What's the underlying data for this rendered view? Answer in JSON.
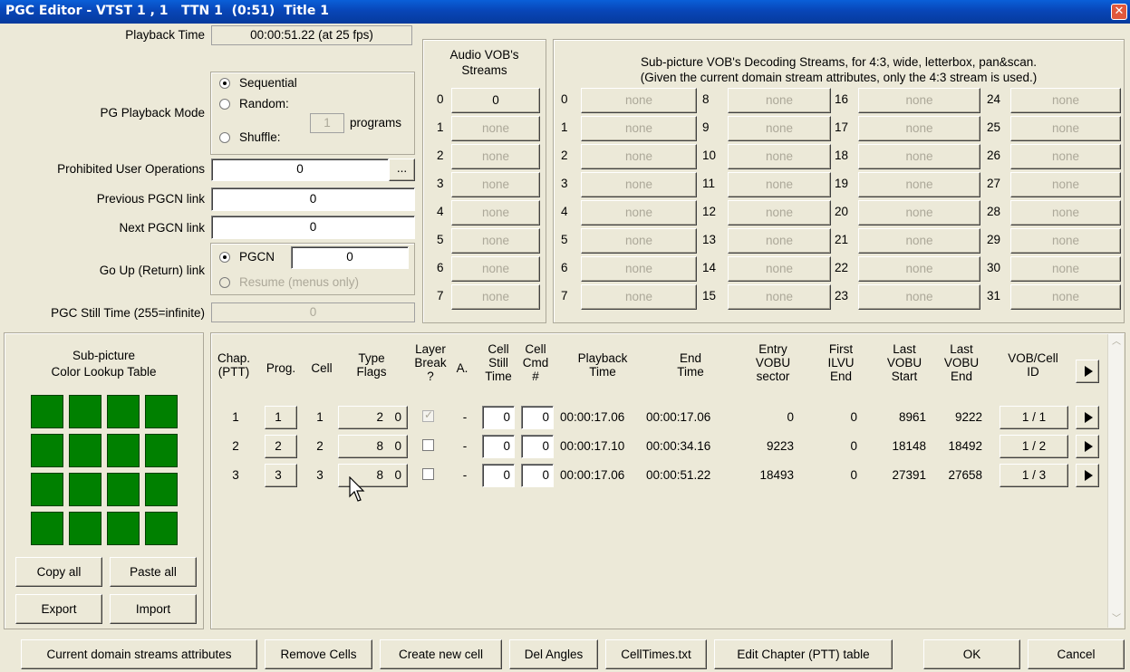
{
  "window": {
    "title": "PGC Editor - VTST 1 , 1   TTN 1  (0:51)  Title 1",
    "close_glyph": "✕"
  },
  "left_form": {
    "playback_time_label": "Playback Time",
    "playback_time_value": "00:00:51.22 (at 25 fps)",
    "pg_playback_mode_label": "PG Playback Mode",
    "mode_sequential": "Sequential",
    "mode_random": "Random:",
    "mode_shuffle": "Shuffle:",
    "programs_value": "1",
    "programs_label": "programs",
    "prohibited_label": "Prohibited User Operations",
    "prohibited_value": "0",
    "prohibited_more": "...",
    "prev_pgcn_label": "Previous PGCN link",
    "prev_pgcn_value": "0",
    "next_pgcn_label": "Next PGCN link",
    "next_pgcn_value": "0",
    "go_up_label": "Go Up (Return) link",
    "pgcn_radio_label": "PGCN",
    "go_up_pgcn_value": "0",
    "resume_label": "Resume (menus only)",
    "still_time_label": "PGC Still Time (255=infinite)",
    "still_time_value": "0"
  },
  "audio": {
    "header_line1": "Audio VOB's",
    "header_line2": "Streams",
    "streams": [
      {
        "index": "0",
        "value": "0"
      },
      {
        "index": "1",
        "value": "none"
      },
      {
        "index": "2",
        "value": "none"
      },
      {
        "index": "3",
        "value": "none"
      },
      {
        "index": "4",
        "value": "none"
      },
      {
        "index": "5",
        "value": "none"
      },
      {
        "index": "6",
        "value": "none"
      },
      {
        "index": "7",
        "value": "none"
      }
    ]
  },
  "subpicture": {
    "header_line1": "Sub-picture VOB's Decoding Streams, for 4:3, wide, letterbox, pan&scan.",
    "header_line2": "(Given the current domain stream attributes, only the 4:3 stream is used.)",
    "columns": [
      [
        {
          "index": "0",
          "value": "none"
        },
        {
          "index": "1",
          "value": "none"
        },
        {
          "index": "2",
          "value": "none"
        },
        {
          "index": "3",
          "value": "none"
        },
        {
          "index": "4",
          "value": "none"
        },
        {
          "index": "5",
          "value": "none"
        },
        {
          "index": "6",
          "value": "none"
        },
        {
          "index": "7",
          "value": "none"
        }
      ],
      [
        {
          "index": "8",
          "value": "none"
        },
        {
          "index": "9",
          "value": "none"
        },
        {
          "index": "10",
          "value": "none"
        },
        {
          "index": "11",
          "value": "none"
        },
        {
          "index": "12",
          "value": "none"
        },
        {
          "index": "13",
          "value": "none"
        },
        {
          "index": "14",
          "value": "none"
        },
        {
          "index": "15",
          "value": "none"
        }
      ],
      [
        {
          "index": "16",
          "value": "none"
        },
        {
          "index": "17",
          "value": "none"
        },
        {
          "index": "18",
          "value": "none"
        },
        {
          "index": "19",
          "value": "none"
        },
        {
          "index": "20",
          "value": "none"
        },
        {
          "index": "21",
          "value": "none"
        },
        {
          "index": "22",
          "value": "none"
        },
        {
          "index": "23",
          "value": "none"
        }
      ],
      [
        {
          "index": "24",
          "value": "none"
        },
        {
          "index": "25",
          "value": "none"
        },
        {
          "index": "26",
          "value": "none"
        },
        {
          "index": "27",
          "value": "none"
        },
        {
          "index": "28",
          "value": "none"
        },
        {
          "index": "29",
          "value": "none"
        },
        {
          "index": "30",
          "value": "none"
        },
        {
          "index": "31",
          "value": "none"
        }
      ]
    ]
  },
  "color_lut": {
    "title_line1": "Sub-picture",
    "title_line2": "Color Lookup Table",
    "swatch_color": "#008000",
    "copy_all": "Copy all",
    "paste_all": "Paste all",
    "export": "Export",
    "import": "Import"
  },
  "cells": {
    "headers": {
      "chap": [
        "Chap.",
        "(PTT)"
      ],
      "prog": [
        "Prog."
      ],
      "cell": [
        "Cell"
      ],
      "type": [
        "Type",
        "Flags"
      ],
      "layer": [
        "Layer",
        "Break",
        "?"
      ],
      "a": [
        "A."
      ],
      "still": [
        "Cell",
        "Still",
        "Time"
      ],
      "cmd": [
        "Cell",
        "Cmd",
        "#"
      ],
      "playback": [
        "Playback",
        "Time"
      ],
      "end": [
        "End",
        "Time"
      ],
      "entry": [
        "Entry",
        "VOBU",
        "sector"
      ],
      "first": [
        "First",
        "ILVU",
        "End"
      ],
      "lvs": [
        "Last",
        "VOBU",
        "Start"
      ],
      "lve": [
        "Last",
        "VOBU",
        "End"
      ],
      "vob": [
        "VOB/Cell",
        "ID"
      ]
    },
    "rows": [
      {
        "chap": "1",
        "prog": "1",
        "cell": "1",
        "type_a": "2",
        "type_b": "0",
        "layer_break": true,
        "a": "-",
        "still": "0",
        "cmd": "0",
        "playback": "00:00:17.06",
        "end": "00:00:17.06",
        "entry": "0",
        "first": "0",
        "lvs": "8961",
        "lve": "9222",
        "vob": "1 / 1"
      },
      {
        "chap": "2",
        "prog": "2",
        "cell": "2",
        "type_a": "8",
        "type_b": "0",
        "layer_break": false,
        "a": "-",
        "still": "0",
        "cmd": "0",
        "playback": "00:00:17.10",
        "end": "00:00:34.16",
        "entry": "9223",
        "first": "0",
        "lvs": "18148",
        "lve": "18492",
        "vob": "1 / 2"
      },
      {
        "chap": "3",
        "prog": "3",
        "cell": "3",
        "type_a": "8",
        "type_b": "0",
        "layer_break": false,
        "a": "-",
        "still": "0",
        "cmd": "0",
        "playback": "00:00:17.06",
        "end": "00:00:51.22",
        "entry": "18493",
        "first": "0",
        "lvs": "27391",
        "lve": "27658",
        "vob": "1 / 3"
      }
    ]
  },
  "bottom_buttons": {
    "current_domain": "Current domain streams attributes",
    "remove_cells": "Remove Cells",
    "create_cell": "Create new cell",
    "del_angles": "Del Angles",
    "celltimes": "CellTimes.txt",
    "edit_chapter": "Edit Chapter (PTT) table",
    "ok": "OK",
    "cancel": "Cancel"
  }
}
